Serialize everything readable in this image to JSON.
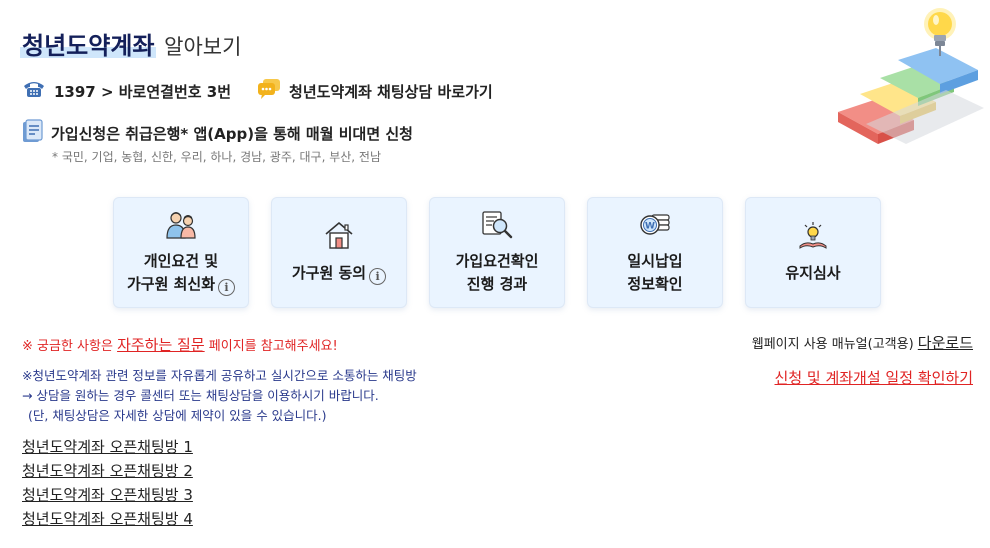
{
  "header": {
    "title_brand": "청년도약계좌",
    "title_sub": "알아보기"
  },
  "contact": {
    "phone_text": "1397 > 바로연결번호 3번",
    "chat_label": "청년도약계좌 채팅상담 바로가기"
  },
  "apply": {
    "text": "가입신청은 취급은행* 앱(App)을 통해 매월 비대면 신청",
    "banks_note": "* 국민, 기업, 농협, 신한, 우리, 하나, 경남, 광주, 대구, 부산, 전남"
  },
  "cards": [
    {
      "line1": "개인요건 및",
      "line2": "가구원 최신화",
      "icon": "family-icon",
      "info": "i"
    },
    {
      "line1": "가구원 동의",
      "icon": "house-icon",
      "info": "i"
    },
    {
      "line1": "가입요건확인",
      "line2": "진행 경과",
      "icon": "document-search-icon"
    },
    {
      "line1": "일시납입",
      "line2": "정보확인",
      "icon": "coin-stack-icon"
    },
    {
      "line1": "유지심사",
      "icon": "reading-lamp-icon"
    }
  ],
  "faq": {
    "prefix": "※ 궁금한 사항은 ",
    "link": "자주하는 질문",
    "suffix": " 페이지를 참고해주세요!"
  },
  "manual": {
    "prefix": "웹페이지 사용 매뉴얼(고객용) ",
    "link": "다운로드"
  },
  "schedule_link": "신청 및 계좌개설 일정 확인하기",
  "notes": {
    "line1": "※청년도약계좌 관련 정보를 자유롭게 공유하고 실시간으로 소통하는 채팅방",
    "line2": "→ 상담을 원하는 경우 콜센터 또는 채팅상담을 이용하시기 바랍니다.",
    "line3": "(단, 채팅상담은 자세한 상담에 제약이 있을 수 있습니다.)"
  },
  "open_chats": [
    "청년도약계좌 오픈채팅방 1",
    "청년도약계좌 오픈채팅방 2",
    "청년도약계좌 오픈채팅방 3",
    "청년도약계좌 오픈채팅방 4"
  ],
  "colors": {
    "brand_navy": "#14205a",
    "accent_red": "#e02424",
    "note_blue": "#2a3a8c",
    "card_bg": "#eaf4ff"
  }
}
